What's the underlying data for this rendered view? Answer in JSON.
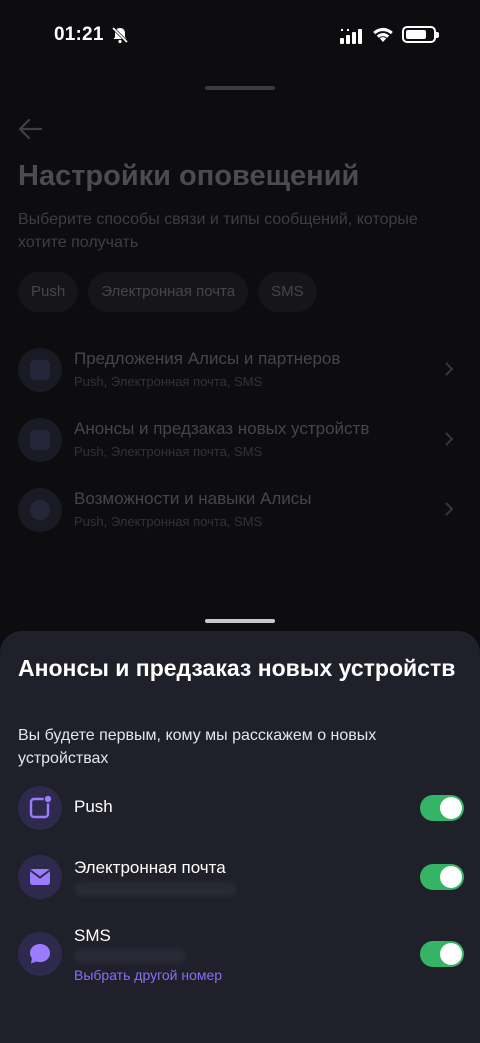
{
  "status_bar": {
    "time": "01:21"
  },
  "background": {
    "title": "Настройки оповещений",
    "subtitle": "Выберите способы связи и типы сообщений, которые хотите получать",
    "chips": [
      "Push",
      "Электронная почта",
      "SMS"
    ],
    "items": [
      {
        "title": "Предложения Алисы и партнеров",
        "subtitle": "Push, Электронная почта, SMS"
      },
      {
        "title": "Анонсы и предзаказ новых устройств",
        "subtitle": "Push, Электронная почта, SMS"
      },
      {
        "title": "Возможности и навыки Алисы",
        "subtitle": "Push, Электронная почта, SMS"
      }
    ]
  },
  "sheet": {
    "title": "Анонсы и предзаказ новых устройств",
    "description": "Вы будете первым, кому мы расскажем о новых устройствах",
    "channels": [
      {
        "label": "Push",
        "enabled": true
      },
      {
        "label": "Электронная почта",
        "enabled": true
      },
      {
        "label": "SMS",
        "enabled": true,
        "link": "Выбрать другой номер"
      }
    ]
  },
  "colors": {
    "accent": "#8a6df5",
    "toggle_on": "#36b465",
    "sheet_bg": "#20202b"
  }
}
